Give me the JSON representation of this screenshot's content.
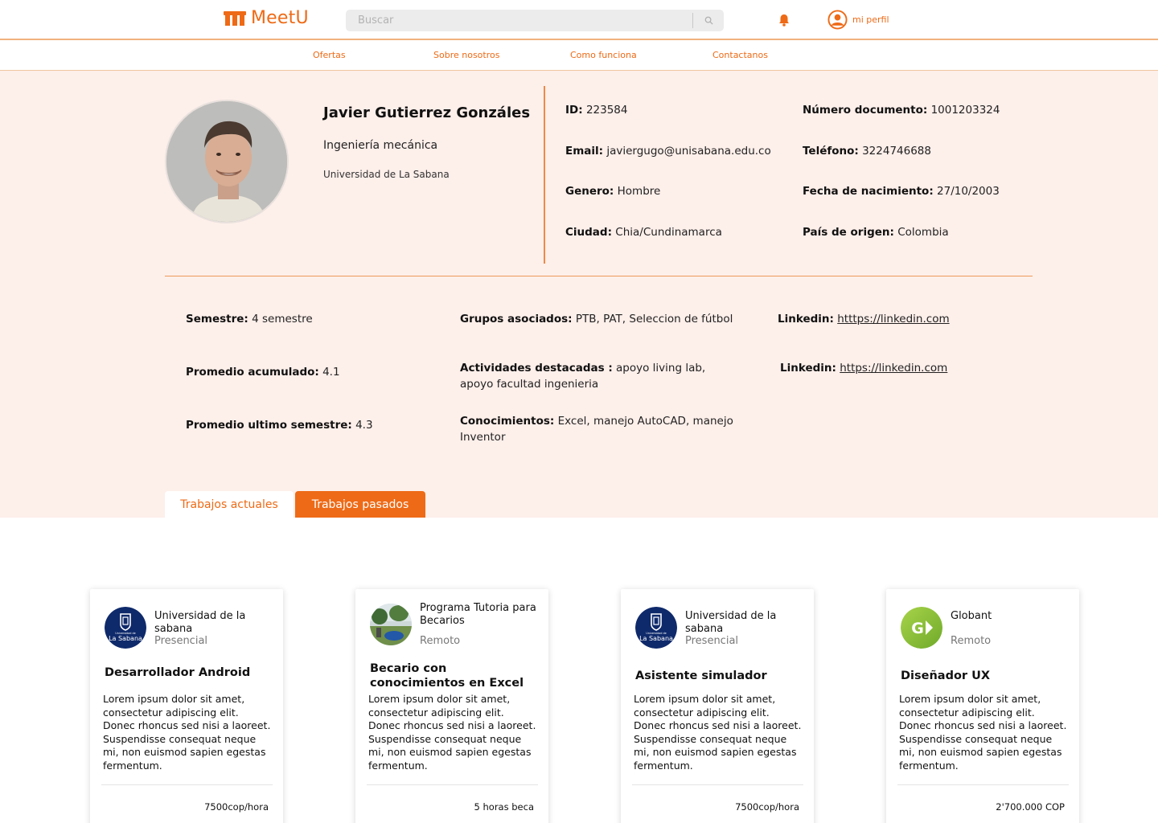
{
  "header": {
    "app_name": "MeetU",
    "search_placeholder": "Buscar",
    "profile_label": "mi perfil",
    "accent_color": "#ee6a16"
  },
  "nav": {
    "items": [
      {
        "label": "Ofertas"
      },
      {
        "label": "Sobre nosotros"
      },
      {
        "label": "Como funciona"
      },
      {
        "label": "Contactanos"
      }
    ]
  },
  "profile": {
    "name": "Javier Gutierrez Gonzáles",
    "career": "Ingeniería mecánica",
    "university": "Universidad de La Sabana",
    "info": {
      "id_label": "ID:",
      "id_value": "223584",
      "doc_label": "Número documento:",
      "doc_value": "1001203324",
      "email_label": "Email:",
      "email_value": "javiergugo@unisabana.edu.co",
      "phone_label": "Teléfono:",
      "phone_value": "3224746688",
      "gender_label": "Genero:",
      "gender_value": "Hombre",
      "birth_label": "Fecha de nacimiento:",
      "birth_value": "27/10/2003",
      "city_label": "Ciudad:",
      "city_value": "Chia/Cundinamarca",
      "country_label": "País de origen:",
      "country_value": "Colombia"
    },
    "academic": {
      "semester_label": "Semestre:",
      "semester_value": "4 semestre",
      "avg_label": "Promedio acumulado:",
      "avg_value": "4.1",
      "last_avg_label": "Promedio ultimo semestre:",
      "last_avg_value": "4.3",
      "groups_label": "Grupos asociados:",
      "groups_value": "PTB, PAT, Seleccion de fútbol",
      "activities_label": "Actividades destacadas :",
      "activities_value": "apoyo living lab, apoyo facultad ingenieria",
      "knowledge_label": "Conocimientos:",
      "knowledge_value": "Excel, manejo AutoCAD, manejo Inventor",
      "linkedin1_label": "Linkedin:",
      "linkedin1_value": "htttps://linkedin.com",
      "linkedin2_label": "Linkedin:",
      "linkedin2_value": "https://linkedin.com"
    }
  },
  "tabs": {
    "current": "Trabajos actuales",
    "past": "Trabajos pasados"
  },
  "cards": [
    {
      "company": "Universidad de la sabana",
      "modality": "Presencial",
      "title": "Desarrollador Android",
      "description": "Lorem ipsum dolor sit amet, consectetur adipiscing elit. Donec rhoncus sed nisi a laoreet. Suspendisse consequat neque mi, non euismod sapien egestas fermentum.",
      "price": "7500cop/hora",
      "logo_text_top": "Universidad de",
      "logo_text": "La Sabana"
    },
    {
      "company": "Programa Tutoria para Becarios",
      "modality": "Remoto",
      "title": "Becario con conocimientos en Excel",
      "description": "Lorem ipsum dolor sit amet, consectetur adipiscing elit. Donec rhoncus sed nisi a laoreet. Suspendisse consequat neque mi, non euismod sapien egestas fermentum.",
      "price": "5 horas beca"
    },
    {
      "company": "Universidad de la sabana",
      "modality": "Presencial",
      "title": "Asistente simulador",
      "description": "Lorem ipsum dolor sit amet, consectetur adipiscing elit. Donec rhoncus sed nisi a laoreet. Suspendisse consequat neque mi, non euismod sapien egestas fermentum.",
      "price": "7500cop/hora",
      "logo_text_top": "Universidad de",
      "logo_text": "La Sabana"
    },
    {
      "company": "Globant",
      "modality": "Remoto",
      "title": "Diseñador UX",
      "description": "Lorem ipsum dolor sit amet, consectetur adipiscing elit. Donec rhoncus sed nisi a laoreet. Suspendisse consequat neque mi, non euismod sapien egestas fermentum.",
      "price": "2'700.000 COP",
      "logo_text": "G"
    }
  ]
}
